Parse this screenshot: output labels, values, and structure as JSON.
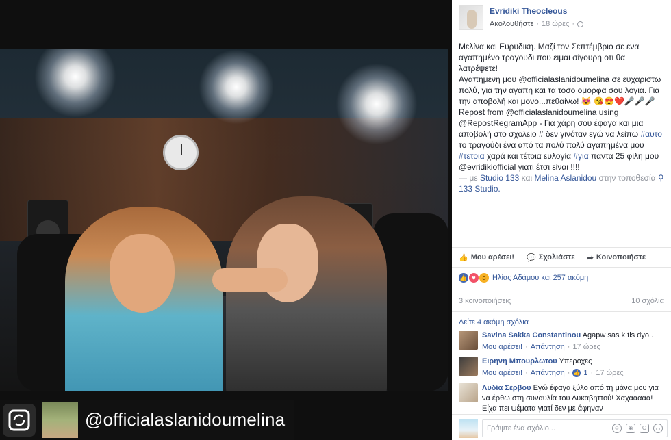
{
  "post": {
    "author": "Evridiki Theocleous",
    "follow_label": "Ακολουθήστε",
    "time": "18 ώρες",
    "text": {
      "line1": "Μελίνα και Ευρυδικη. Μαζί τον Σεπτέμβριο σε ενα αγαπημένο τραγουδι που ειμαι σίγουρη οτι θα λατρέψετε!",
      "line2a": "Αγαπημενη μου @officialaslanidoumelina σε ευχαριστω πολύ, για την αγαπη και τα τοσο ομορφα σου λογια. Για την αποβολή και μονο...πεθαίνω! 😻",
      "line2b": "😘😍❤️🎤🎤🎤Repost from @officialaslanidoumelina using @RepostRegramApp - Για χάρη σου έφαγα και μια αποβολή στο σχολείο # δεν γινόταν εγώ να λείπω",
      "hashtag1": "#αυτο",
      "line2c": " το τραγούδι ένα από τα πολύ πολύ αγαπημένα μου ",
      "hashtag2": "#τετοια",
      "line2d": " χαρά και τέτοια ευλογία ",
      "hashtag3": "#για",
      "line2e": " παντα 25 φίλη μου @evridikiofficial γιατί έτσι είναι !!!!",
      "with_prefix": "— με ",
      "with_place": "Studio 133",
      "with_and": " και ",
      "with_person": "Melina Aslanidou",
      "loc_prefix": " στην τοποθεσία ",
      "location": "133 Studio."
    }
  },
  "actions": {
    "like": "Μου αρέσει!",
    "comment": "Σχολιάστε",
    "share": "Κοινοποιήστε"
  },
  "reactions": {
    "text": "Ηλίας Αδάμου και 257 ακόμη"
  },
  "stats": {
    "shares": "3 κοινοποιήσεις",
    "comments": "10 σχόλια"
  },
  "more_comments": "Δείτε 4 ακόμη σχόλια",
  "comments": [
    {
      "name": "Savina Sakka Constantinou",
      "text": "Agapw sas k tis dyo..",
      "like": "Μου αρέσει!",
      "reply": "Απάντηση",
      "time": "17 ώρες"
    },
    {
      "name": "Ειρηνη Μπουρλωτου",
      "text": "Υπεροχες",
      "like": "Μου αρέσει!",
      "reply": "Απάντηση",
      "likes": "1",
      "time": "17 ώρες"
    },
    {
      "name": "Λυδία Σέρβου",
      "text": "Εγώ έφαγα ξύλο από τη μάνα μου για να έρθω στη συναυλία του Λυκαβηττού! Χαχααααα! Είχα πει ψέματα γιατί δεν με άφηναν"
    }
  ],
  "composer": {
    "placeholder": "Γράψτε ένα σχόλιο..."
  },
  "watermark": {
    "username": "@officialaslanidoumelina"
  },
  "colors": {
    "link": "#365899",
    "muted": "#90949c",
    "text": "#1d2129"
  }
}
